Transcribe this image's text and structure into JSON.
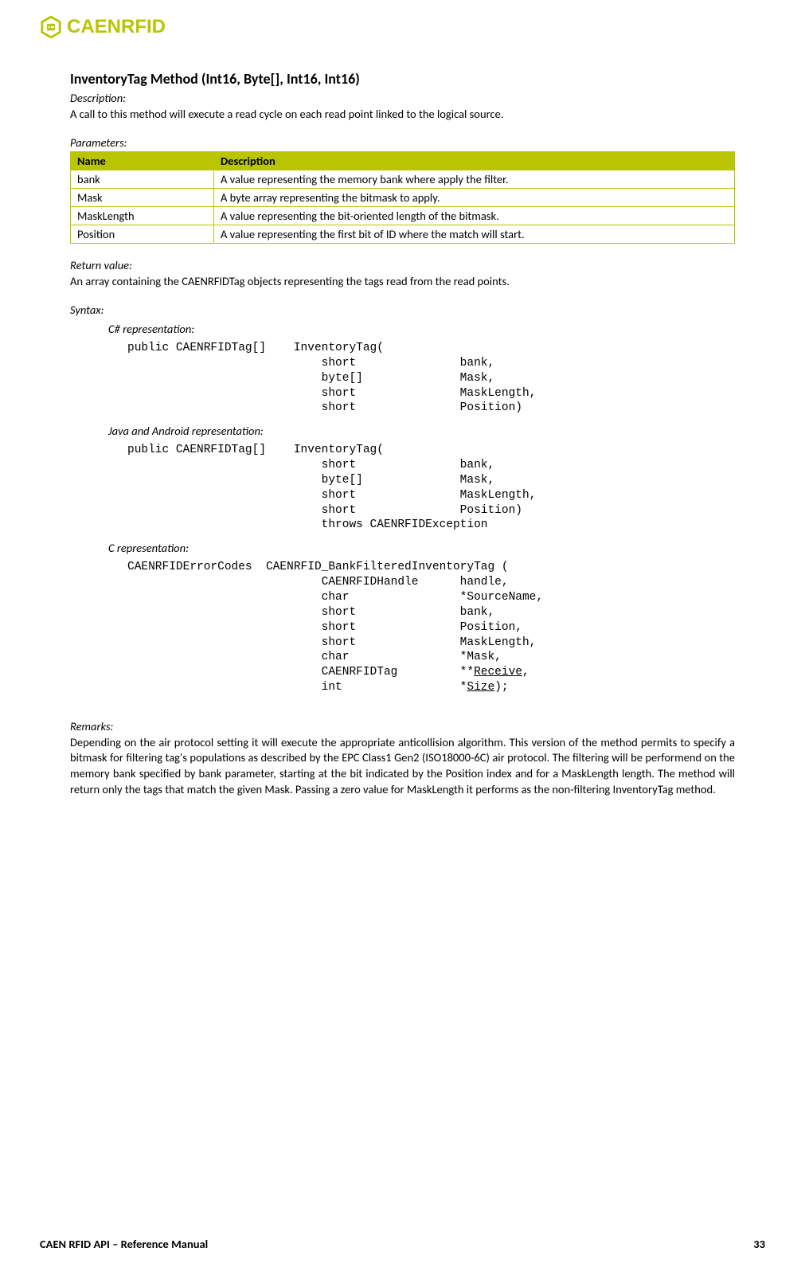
{
  "brand": "CAENRFID",
  "method_title": "InventoryTag Method (Int16, Byte[], Int16, Int16)",
  "labels": {
    "description": "Description:",
    "parameters": "Parameters:",
    "return_value": "Return value:",
    "syntax": "Syntax:",
    "remarks": "Remarks:"
  },
  "description_text": "A call to this method will execute a read cycle on each read point linked to the logical source.",
  "params_table": {
    "headers": [
      "Name",
      "Description"
    ],
    "rows": [
      [
        "bank",
        "A value representing the memory bank where apply the filter."
      ],
      [
        "Mask",
        "A byte array representing the bitmask to apply."
      ],
      [
        "MaskLength",
        "A value representing the bit-oriented length of the bitmask."
      ],
      [
        "Position",
        "A value representing the first bit of ID where the match will start."
      ]
    ]
  },
  "return_text": "An array containing the CAENRFIDTag objects representing the tags read from the read points.",
  "representations": {
    "csharp": {
      "label": "C# representation:",
      "code": "public CAENRFIDTag[]    InventoryTag(\n                            short               bank,\n                            byte[]              Mask,\n                            short               MaskLength,\n                            short               Position)"
    },
    "java": {
      "label": "Java and Android representation:",
      "code": "public CAENRFIDTag[]    InventoryTag(\n                            short               bank,\n                            byte[]              Mask,\n                            short               MaskLength,\n                            short               Position)\n                            throws CAENRFIDException"
    },
    "c": {
      "label": "C representation:",
      "code_prefix": "CAENRFIDErrorCodes  CAENRFID_BankFilteredInventoryTag (\n                            CAENRFIDHandle      handle,\n                            char                *SourceName,\n                            short               bank,\n                            short               Position,\n                            short               MaskLength,\n                            char                *Mask,\n                            CAENRFIDTag         **",
      "receive": "Receive",
      "mid": ",\n                            int                 *",
      "size": "Size",
      "suffix": ");"
    }
  },
  "remarks_text": "Depending on the air protocol setting it will execute the appropriate anticollision algorithm. This version of the method permits to specify a bitmask for filtering tag's populations as described by the EPC Class1 Gen2 (ISO18000-6C) air protocol. The filtering will be performend on the memory bank specified by bank parameter, starting at the bit indicated by the Position index and for a MaskLength length. The method will return only the tags that match the given Mask. Passing a zero value for MaskLength it performs as the non-filtering InventoryTag method.",
  "footer": {
    "left": "CAEN RFID API – Reference Manual",
    "right": "33"
  }
}
